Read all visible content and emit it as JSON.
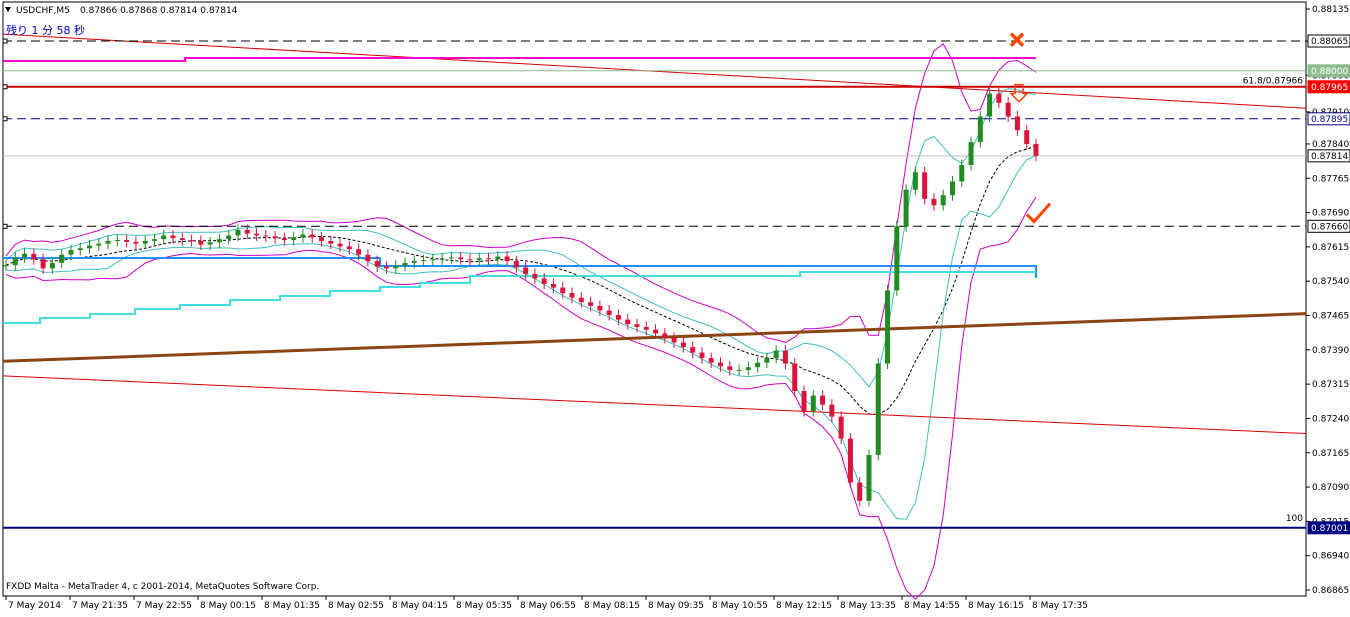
{
  "header": {
    "symbol": "USDCHF,M5",
    "quote": "0.87866 0.87868 0.87814 0.87814",
    "timer": "残り 1 分 58 秒"
  },
  "footer": {
    "copyright": "FXDD Malta - MetaTrader 4, c 2001-2014, MetaQuotes Software Corp."
  },
  "chart_data": {
    "type": "candlestick",
    "ylim": [
      0.86865,
      0.88135
    ],
    "y_ticks": [
      "0.88135",
      "0.88065",
      "0.87990",
      "0.87910",
      "0.87840",
      "0.87765",
      "0.87690",
      "0.87615",
      "0.87540",
      "0.87465",
      "0.87390",
      "0.87315",
      "0.87240",
      "0.87165",
      "0.87090",
      "0.87015",
      "0.86940",
      "0.86865"
    ],
    "x_ticks": [
      "7 May 2014",
      "7 May 21:35",
      "7 May 22:55",
      "8 May 00:15",
      "8 May 01:35",
      "8 May 02:55",
      "8 May 04:15",
      "8 May 05:35",
      "8 May 06:55",
      "8 May 08:15",
      "8 May 09:35",
      "8 May 10:55",
      "8 May 12:15",
      "8 May 13:35",
      "8 May 14:55",
      "8 May 16:15",
      "8 May 17:35"
    ],
    "price_labels": [
      {
        "text": "0.88065",
        "value": 0.88065,
        "bg": "#ffffff",
        "fg": "#000000",
        "border": "#000000"
      },
      {
        "text": "0.88000",
        "value": 0.88,
        "bg": "#8fbc8f",
        "fg": "#ffffff",
        "border": "#8fbc8f"
      },
      {
        "text": "0.87965",
        "value": 0.87965,
        "bg": "#ff0000",
        "fg": "#ffffff",
        "border": "#ff0000"
      },
      {
        "text": "0.87895",
        "value": 0.87895,
        "bg": "#ffffff",
        "fg": "#000080",
        "border": "#000080"
      },
      {
        "text": "0.87814",
        "value": 0.87814,
        "bg": "#ffffff",
        "fg": "#000000",
        "border": "#000000"
      },
      {
        "text": "0.87660",
        "value": 0.8766,
        "bg": "#ffffff",
        "fg": "#000000",
        "border": "#000000"
      },
      {
        "text": "0.87001",
        "value": 0.87001,
        "bg": "#000080",
        "fg": "#ffffff",
        "border": "#000080"
      }
    ],
    "annotations": [
      {
        "text": "61.8/0.87966",
        "value": 0.87966
      },
      {
        "text": "100",
        "value": 0.87009
      }
    ],
    "hlines": [
      {
        "value": 0.88065,
        "color": "#000000",
        "dash": true
      },
      {
        "value": 0.88,
        "color": "#8fbc8f",
        "dash": false
      },
      {
        "value": 0.87965,
        "color": "#cc0000",
        "dash": false,
        "thick": true
      },
      {
        "value": 0.87895,
        "color": "#000080",
        "dash": true
      },
      {
        "value": 0.87814,
        "color": "#c0c0c0",
        "dash": false
      },
      {
        "value": 0.8766,
        "color": "#000000",
        "dash": true
      },
      {
        "value": 0.87001,
        "color": "#000080",
        "dash": false,
        "thick": true
      }
    ],
    "close_path": [
      0.87575,
      0.87592,
      0.876,
      0.87588,
      0.87568,
      0.8758,
      0.87598,
      0.87608,
      0.87612,
      0.87618,
      0.87622,
      0.87628,
      0.8763,
      0.87626,
      0.87622,
      0.87628,
      0.87632,
      0.8764,
      0.87634,
      0.8763,
      0.87628,
      0.8762,
      0.87625,
      0.87632,
      0.8764,
      0.87652,
      0.87644,
      0.8764,
      0.87638,
      0.87634,
      0.8763,
      0.87636,
      0.87642,
      0.87636,
      0.87628,
      0.87622,
      0.87616,
      0.8761,
      0.87598,
      0.87584,
      0.87572,
      0.87568,
      0.87574,
      0.8758,
      0.87584,
      0.87586,
      0.87588,
      0.8759,
      0.87592,
      0.87588,
      0.87586,
      0.8759,
      0.87588,
      0.87594,
      0.87584,
      0.8757,
      0.87556,
      0.87546,
      0.87534,
      0.87526,
      0.87514,
      0.87504,
      0.87494,
      0.87486,
      0.87476,
      0.87466,
      0.87456,
      0.87446,
      0.8744,
      0.87434,
      0.87426,
      0.87416,
      0.87406,
      0.87396,
      0.87384,
      0.87372,
      0.87362,
      0.87354,
      0.87346,
      0.87346,
      0.87352,
      0.87362,
      0.87372,
      0.87388,
      0.8736,
      0.873,
      0.87256,
      0.8729,
      0.8727,
      0.87244,
      0.87196,
      0.871,
      0.8706,
      0.8716,
      0.8736,
      0.8752,
      0.8766,
      0.8774,
      0.87778,
      0.8772,
      0.87706,
      0.87728,
      0.87758,
      0.87794,
      0.87844,
      0.879,
      0.8795,
      0.8793,
      0.879,
      0.8787,
      0.8784,
      0.87814
    ],
    "markers": [
      {
        "type": "cross",
        "color": "#ff4500",
        "value": 0.88068
      },
      {
        "type": "arrow-down",
        "color": "#ff4500",
        "value": 0.8795
      },
      {
        "type": "check",
        "color": "#ff4500",
        "value": 0.8769
      }
    ]
  }
}
